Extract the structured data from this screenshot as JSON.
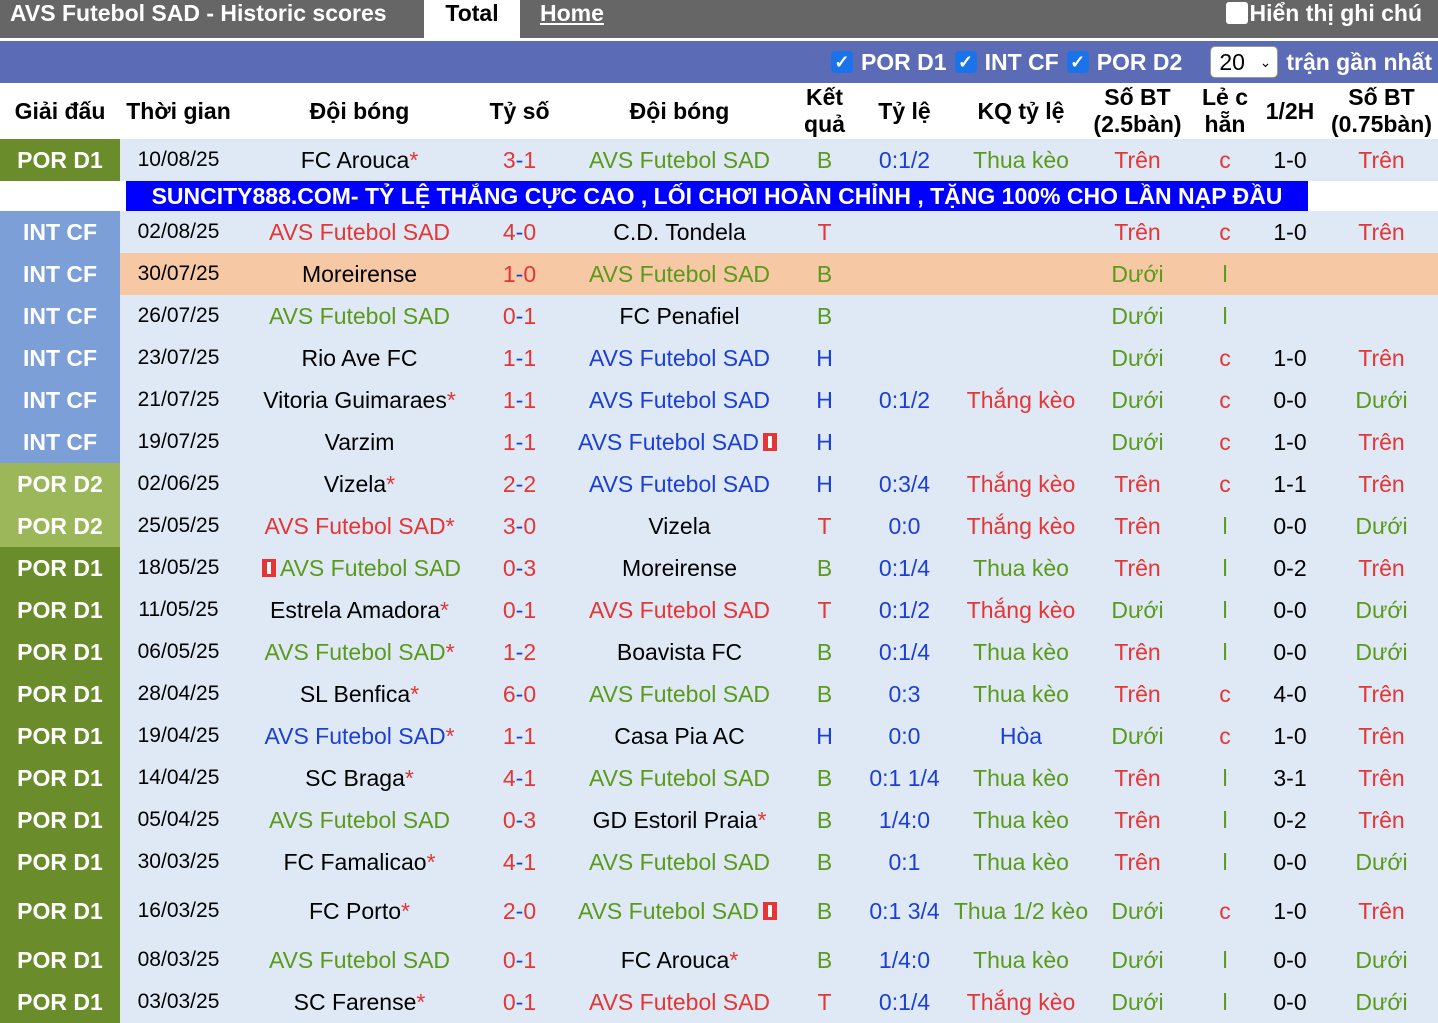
{
  "topbar": {
    "title": "AVS Futebol SAD - Historic scores",
    "tab_total": "Total",
    "tab_home": "Home",
    "show_notes": "Hiển thị ghi chú"
  },
  "filters": {
    "f1": "POR D1",
    "f2": "INT CF",
    "f3": "POR D2",
    "select_value": "20",
    "recent_label": "trận gần nhất"
  },
  "headers": {
    "league": "Giải đấu",
    "time": "Thời gian",
    "team1": "Đội bóng",
    "score": "Tỷ số",
    "team2": "Đội bóng",
    "result": "Kết quả",
    "odds": "Tỷ lệ",
    "odds_result": "KQ tỷ lệ",
    "goals25": "Số BT (2.5bàn)",
    "oddeven": "Lẻ c hẵn",
    "half": "1/2H",
    "goals075": "Số BT (0.75bàn)"
  },
  "banner": "SUNCITY888.COM- TỶ LỆ THẮNG CỰC CAO , LỐI CHƠI HOÀN CHỈNH , TẶNG 100% CHO LẦN NẠP ĐẦU",
  "rows": [
    {
      "league": "POR D1",
      "date": "10/08/25",
      "team1": "FC Arouca",
      "score": "3-1",
      "team2": "AVS Futebol SAD",
      "res": "B",
      "odds": "0:1/2",
      "oddsres": "Thua kèo",
      "g25": "Trên",
      "oe": "c",
      "half": "1-0",
      "g075": "Trên"
    },
    {
      "league": "INT CF",
      "date": "02/08/25",
      "team1": "AVS Futebol SAD",
      "score": "4-0",
      "team2": "C.D. Tondela",
      "res": "T",
      "odds": "",
      "oddsres": "",
      "g25": "Trên",
      "oe": "c",
      "half": "1-0",
      "g075": "Trên"
    },
    {
      "league": "INT CF",
      "date": "30/07/25",
      "team1": "Moreirense",
      "score": "1-0",
      "team2": "AVS Futebol SAD",
      "res": "B",
      "odds": "",
      "oddsres": "",
      "g25": "Dưới",
      "oe": "l",
      "half": "",
      "g075": ""
    },
    {
      "league": "INT CF",
      "date": "26/07/25",
      "team1": "AVS Futebol SAD",
      "score": "0-1",
      "team2": "FC Penafiel",
      "res": "B",
      "odds": "",
      "oddsres": "",
      "g25": "Dưới",
      "oe": "l",
      "half": "",
      "g075": ""
    },
    {
      "league": "INT CF",
      "date": "23/07/25",
      "team1": "Rio Ave FC",
      "score": "1-1",
      "team2": "AVS Futebol SAD",
      "res": "H",
      "odds": "",
      "oddsres": "",
      "g25": "Dưới",
      "oe": "c",
      "half": "1-0",
      "g075": "Trên"
    },
    {
      "league": "INT CF",
      "date": "21/07/25",
      "team1": "Vitoria Guimaraes",
      "score": "1-1",
      "team2": "AVS Futebol SAD",
      "res": "H",
      "odds": "0:1/2",
      "oddsres": "Thắng kèo",
      "g25": "Dưới",
      "oe": "c",
      "half": "0-0",
      "g075": "Dưới"
    },
    {
      "league": "INT CF",
      "date": "19/07/25",
      "team1": "Varzim",
      "score": "1-1",
      "team2": "AVS Futebol SAD",
      "res": "H",
      "odds": "",
      "oddsres": "",
      "g25": "Dưới",
      "oe": "c",
      "half": "1-0",
      "g075": "Trên"
    },
    {
      "league": "POR D2",
      "date": "02/06/25",
      "team1": "Vizela",
      "score": "2-2",
      "team2": "AVS Futebol SAD",
      "res": "H",
      "odds": "0:3/4",
      "oddsres": "Thắng kèo",
      "g25": "Trên",
      "oe": "c",
      "half": "1-1",
      "g075": "Trên"
    },
    {
      "league": "POR D2",
      "date": "25/05/25",
      "team1": "AVS Futebol SAD",
      "score": "3-0",
      "team2": "Vizela",
      "res": "T",
      "odds": "0:0",
      "oddsres": "Thắng kèo",
      "g25": "Trên",
      "oe": "l",
      "half": "0-0",
      "g075": "Dưới"
    },
    {
      "league": "POR D1",
      "date": "18/05/25",
      "team1": "AVS Futebol SAD",
      "score": "0-3",
      "team2": "Moreirense",
      "res": "B",
      "odds": "0:1/4",
      "oddsres": "Thua kèo",
      "g25": "Trên",
      "oe": "l",
      "half": "0-2",
      "g075": "Trên"
    },
    {
      "league": "POR D1",
      "date": "11/05/25",
      "team1": "Estrela Amadora",
      "score": "0-1",
      "team2": "AVS Futebol SAD",
      "res": "T",
      "odds": "0:1/2",
      "oddsres": "Thắng kèo",
      "g25": "Dưới",
      "oe": "l",
      "half": "0-0",
      "g075": "Dưới"
    },
    {
      "league": "POR D1",
      "date": "06/05/25",
      "team1": "AVS Futebol SAD",
      "score": "1-2",
      "team2": "Boavista FC",
      "res": "B",
      "odds": "0:1/4",
      "oddsres": "Thua kèo",
      "g25": "Trên",
      "oe": "l",
      "half": "0-0",
      "g075": "Dưới"
    },
    {
      "league": "POR D1",
      "date": "28/04/25",
      "team1": "SL Benfica",
      "score": "6-0",
      "team2": "AVS Futebol SAD",
      "res": "B",
      "odds": "0:3",
      "oddsres": "Thua kèo",
      "g25": "Trên",
      "oe": "c",
      "half": "4-0",
      "g075": "Trên"
    },
    {
      "league": "POR D1",
      "date": "19/04/25",
      "team1": "AVS Futebol SAD",
      "score": "1-1",
      "team2": "Casa Pia AC",
      "res": "H",
      "odds": "0:0",
      "oddsres": "Hòa",
      "g25": "Dưới",
      "oe": "c",
      "half": "1-0",
      "g075": "Trên"
    },
    {
      "league": "POR D1",
      "date": "14/04/25",
      "team1": "SC Braga",
      "score": "4-1",
      "team2": "AVS Futebol SAD",
      "res": "B",
      "odds": "0:1 1/4",
      "oddsres": "Thua kèo",
      "g25": "Trên",
      "oe": "l",
      "half": "3-1",
      "g075": "Trên"
    },
    {
      "league": "POR D1",
      "date": "05/04/25",
      "team1": "AVS Futebol SAD",
      "score": "0-3",
      "team2": "GD Estoril Praia",
      "res": "B",
      "odds": "1/4:0",
      "oddsres": "Thua kèo",
      "g25": "Trên",
      "oe": "l",
      "half": "0-2",
      "g075": "Trên"
    },
    {
      "league": "POR D1",
      "date": "30/03/25",
      "team1": "FC Famalicao",
      "score": "4-1",
      "team2": "AVS Futebol SAD",
      "res": "B",
      "odds": "0:1",
      "oddsres": "Thua kèo",
      "g25": "Trên",
      "oe": "l",
      "half": "0-0",
      "g075": "Dưới"
    },
    {
      "league": "POR D1",
      "date": "16/03/25",
      "team1": "FC Porto",
      "score": "2-0",
      "team2": "AVS Futebol SAD",
      "res": "B",
      "odds": "0:1 3/4",
      "oddsres": "Thua 1/2 kèo",
      "g25": "Dưới",
      "oe": "c",
      "half": "1-0",
      "g075": "Trên"
    },
    {
      "league": "POR D1",
      "date": "08/03/25",
      "team1": "AVS Futebol SAD",
      "score": "0-1",
      "team2": "FC Arouca",
      "res": "B",
      "odds": "1/4:0",
      "oddsres": "Thua kèo",
      "g25": "Dưới",
      "oe": "l",
      "half": "0-0",
      "g075": "Dưới"
    },
    {
      "league": "POR D1",
      "date": "03/03/25",
      "team1": "SC Farense",
      "score": "0-1",
      "team2": "AVS Futebol SAD",
      "res": "T",
      "odds": "0:1/4",
      "oddsres": "Thắng kèo",
      "g25": "Dưới",
      "oe": "l",
      "half": "0-0",
      "g075": "Dưới"
    }
  ]
}
